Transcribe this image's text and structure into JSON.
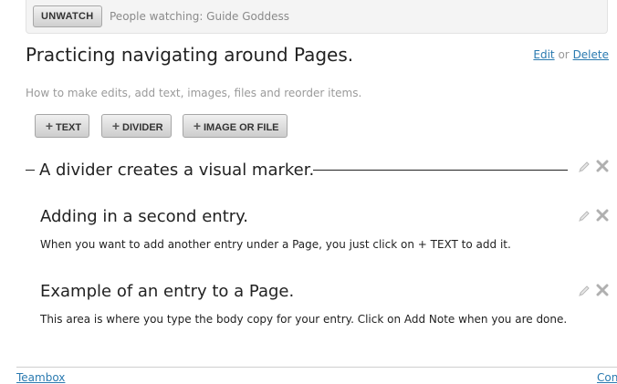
{
  "watch_bar": {
    "button_label": "UNWATCH",
    "watchers_text": "People watching: Guide Goddess"
  },
  "page": {
    "title": "Practicing navigating around Pages.",
    "edit_label": "Edit",
    "or_label": "or",
    "delete_label": "Delete",
    "description": "How to make edits, add text, images, files and reorder items."
  },
  "toolbar": {
    "text_label": "TEXT",
    "divider_label": "DIVIDER",
    "image_file_label": "IMAGE OR FILE"
  },
  "divider": {
    "text": "A divider creates a visual marker."
  },
  "entries": [
    {
      "title": "Adding in a second entry.",
      "body": "When you want to add another entry under a Page, you just click on + TEXT to add it."
    },
    {
      "title": "Example of an entry to a Page.",
      "body": "This area is where you type the body copy for your entry. Click on Add Note when you are done."
    }
  ],
  "footer": {
    "left_link": "Teambox",
    "right_link": "Con"
  },
  "icons": {
    "edit": "pencil-icon",
    "delete": "close-icon",
    "add": "plus-icon"
  }
}
